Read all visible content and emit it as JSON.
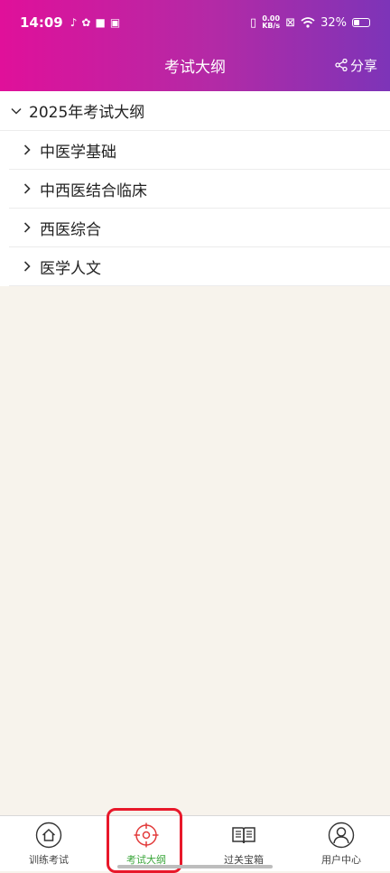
{
  "status_bar": {
    "time": "14:09",
    "speed_value": "0.00",
    "speed_unit": "KB/s",
    "battery": "32%"
  },
  "header": {
    "title": "考试大纲",
    "share_label": "分享"
  },
  "tree": {
    "root": "2025年考试大纲",
    "children": [
      "中医学基础",
      "中西医结合临床",
      "西医综合",
      "医学人文"
    ]
  },
  "tabbar": {
    "tabs": [
      {
        "label": "训练考试",
        "icon": "home-icon"
      },
      {
        "label": "考试大纲",
        "icon": "target-icon"
      },
      {
        "label": "过关宝箱",
        "icon": "book-icon"
      },
      {
        "label": "用户中心",
        "icon": "user-icon"
      }
    ],
    "active_index": 1,
    "active_color": "#3aa63a"
  },
  "colors": {
    "header_gradient_start": "#e0109a",
    "header_gradient_end": "#7d34b8",
    "page_background": "#f7f3ec",
    "highlight_box": "#e8182a"
  }
}
